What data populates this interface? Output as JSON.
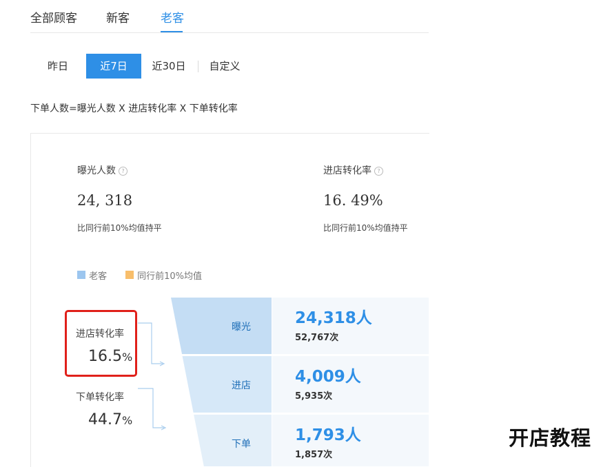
{
  "tabs": [
    {
      "label": "全部顾客",
      "active": false
    },
    {
      "label": "新客",
      "active": false
    },
    {
      "label": "老客",
      "active": true
    }
  ],
  "ranges": [
    {
      "label": "昨日",
      "active": false
    },
    {
      "label": "近7日",
      "active": true
    },
    {
      "label": "近30日",
      "active": false
    },
    {
      "label": "自定义",
      "active": false
    }
  ],
  "formula": "下单人数=曝光人数 X 进店转化率 X 下单转化率",
  "metrics": [
    {
      "label": "曝光人数",
      "help_icon": "question-circle-icon",
      "value": "24, 318",
      "compare": "比同行前10%均值持平"
    },
    {
      "label": "进店转化率",
      "help_icon": "question-circle-icon",
      "value": "16. 49%",
      "compare": "比同行前10%均值持平"
    }
  ],
  "legend": [
    {
      "label": "老客",
      "color": "#9cc6ef"
    },
    {
      "label": "同行前10%均值",
      "color": "#f8be6b"
    }
  ],
  "conversions": [
    {
      "label": "进店转化率",
      "num": "16.5",
      "unit": "%"
    },
    {
      "label": "下单转化率",
      "num": "44.7",
      "unit": "%"
    }
  ],
  "chart_data": {
    "type": "funnel",
    "categories": [
      "曝光",
      "进店",
      "下单"
    ],
    "values": [
      24318,
      4009,
      1793
    ],
    "people_labels": [
      "24,318人",
      "4,009人",
      "1,793人"
    ],
    "times_labels": [
      "52,767次",
      "5,935次",
      "1,857次"
    ],
    "times_values": [
      52767,
      5935,
      1857
    ],
    "colors": [
      "#c4ddf4",
      "#d6e8f8",
      "#e3eff9"
    ]
  },
  "watermark": "开店教程"
}
